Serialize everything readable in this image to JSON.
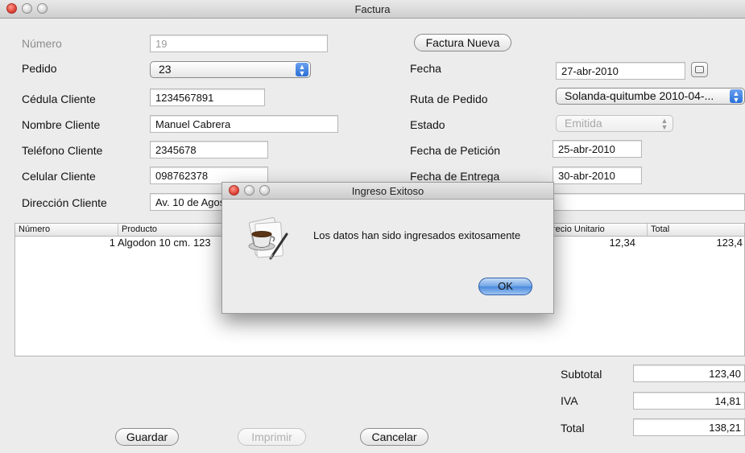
{
  "window": {
    "title": "Factura"
  },
  "form": {
    "numero": {
      "label": "Número",
      "value": "19"
    },
    "nueva_button": "Factura Nueva",
    "pedido": {
      "label": "Pedido",
      "value": "23"
    },
    "fecha": {
      "label": "Fecha",
      "value": "27-abr-2010"
    },
    "cedula": {
      "label": "Cédula Cliente",
      "value": "1234567891"
    },
    "ruta": {
      "label": "Ruta de Pedido",
      "value": "Solanda-quitumbe 2010-04-..."
    },
    "nombre": {
      "label": "Nombre Cliente",
      "value": "Manuel Cabrera"
    },
    "estado": {
      "label": "Estado",
      "value": "Emitida"
    },
    "telefono": {
      "label": "Teléfono Cliente",
      "value": "2345678"
    },
    "fecha_peticion": {
      "label": "Fecha de Petición",
      "value": "25-abr-2010"
    },
    "celular": {
      "label": "Celular Cliente",
      "value": "098762378"
    },
    "fecha_entrega": {
      "label": "Fecha de Entrega",
      "value": "30-abr-2010"
    },
    "direccion": {
      "label": "Dirección Cliente",
      "value": "Av. 10 de Agos"
    }
  },
  "table": {
    "columns": [
      "Número",
      "Producto",
      "recio Unitario",
      "Total"
    ],
    "rows": [
      {
        "numero": "1",
        "producto": "Algodon 10 cm. 123",
        "precio": "12,34",
        "total": "123,4"
      }
    ]
  },
  "totals": {
    "subtotal": {
      "label": "Subtotal",
      "value": "123,40"
    },
    "iva": {
      "label": "IVA",
      "value": "14,81"
    },
    "total": {
      "label": "Total",
      "value": "138,21"
    }
  },
  "buttons": {
    "guardar": "Guardar",
    "imprimir": "Imprimir",
    "cancelar": "Cancelar"
  },
  "dialog": {
    "title": "Ingreso Exitoso",
    "message": "Los datos han sido ingresados exitosamente",
    "ok": "OK"
  }
}
